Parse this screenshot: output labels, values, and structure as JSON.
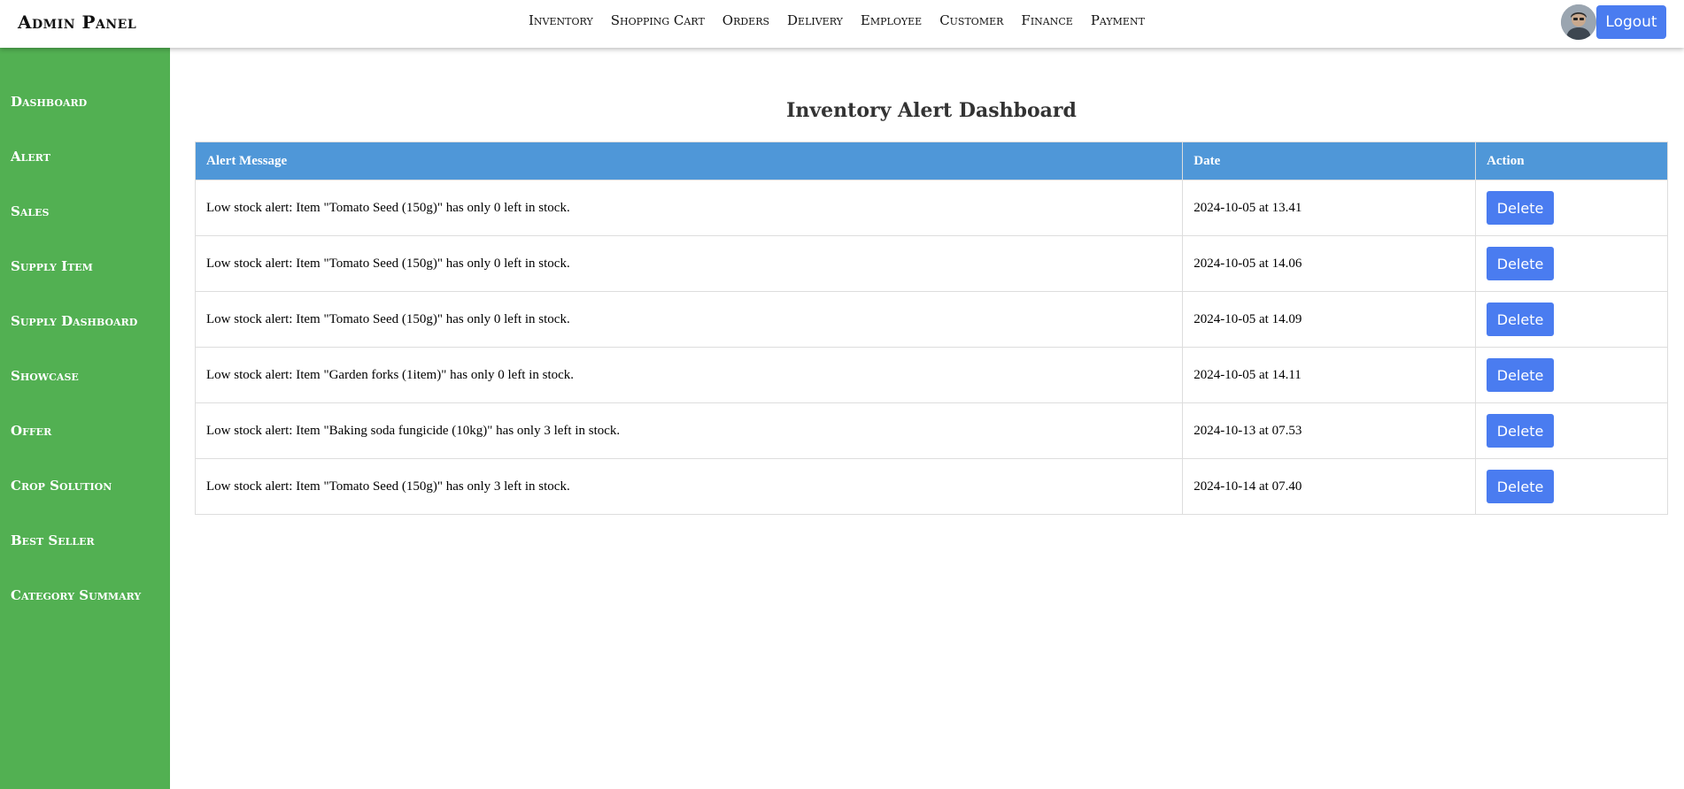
{
  "header": {
    "brand": "Admin Panel",
    "nav": [
      "Inventory",
      "Shopping Cart",
      "Orders",
      "Delivery",
      "Employee",
      "Customer",
      "Finance",
      "Payment"
    ],
    "logout_label": "Logout"
  },
  "sidebar": {
    "items": [
      "Dashboard",
      "Alert",
      "Sales",
      "Supply Item",
      "Supply Dashboard",
      "Showcase",
      "Offer",
      "Crop Solution",
      "Best Seller",
      "Category Summary"
    ]
  },
  "main": {
    "title": "Inventory Alert Dashboard",
    "columns": [
      "Alert Message",
      "Date",
      "Action"
    ],
    "delete_label": "Delete",
    "rows": [
      {
        "message": "Low stock alert: Item \"Tomato Seed (150g)\" has only 0 left in stock.",
        "date": "2024-10-05 at 13.41"
      },
      {
        "message": "Low stock alert: Item \"Tomato Seed (150g)\" has only 0 left in stock.",
        "date": "2024-10-05 at 14.06"
      },
      {
        "message": "Low stock alert: Item \"Tomato Seed (150g)\" has only 0 left in stock.",
        "date": "2024-10-05 at 14.09"
      },
      {
        "message": "Low stock alert: Item \"Garden forks (1item)\" has only 0 left in stock.",
        "date": "2024-10-05 at 14.11"
      },
      {
        "message": "Low stock alert: Item \"Baking soda fungicide (10kg)\" has only 3 left in stock.",
        "date": "2024-10-13 at 07.53"
      },
      {
        "message": "Low stock alert: Item \"Tomato Seed (150g)\" has only 3 left in stock.",
        "date": "2024-10-14 at 07.40"
      }
    ]
  },
  "colors": {
    "sidebar_bg": "#52b052",
    "table_header_bg": "#4f97d8",
    "button_blue": "#4a7cf0"
  }
}
